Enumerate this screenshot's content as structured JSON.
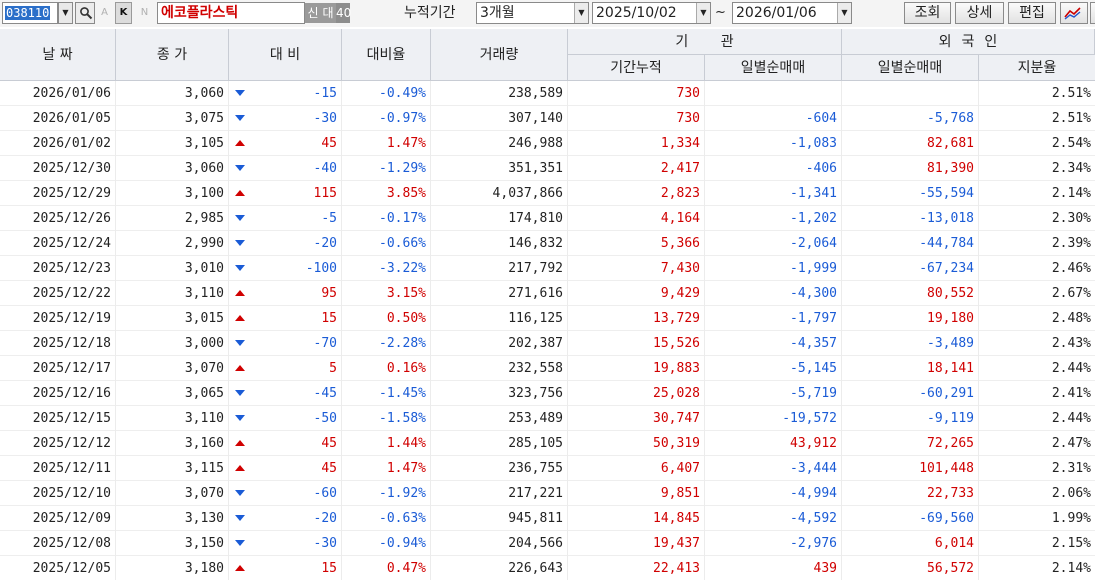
{
  "toolbar": {
    "stock_code": "038110",
    "mini_a": "A",
    "mini_k": "K",
    "mini_n": "N",
    "stock_name": "에코플라스틱",
    "badge_new": "신",
    "badge_credit": "대",
    "badge_margin": "40",
    "period_label": "누적기간",
    "period_value": "3개월",
    "date_from": "2025/10/02",
    "tilde": "~",
    "date_to": "2026/01/06",
    "btn_query": "조회",
    "btn_detail": "상세",
    "btn_edit": "편집"
  },
  "headers": {
    "date": "날 짜",
    "close": "종 가",
    "diff": "대 비",
    "rate": "대비율",
    "volume": "거래량",
    "institution": "기 관",
    "inst_accum": "기간누적",
    "inst_daily": "일별순매매",
    "foreign": "외국인",
    "frn_daily": "일별순매매",
    "frn_share": "지분율"
  },
  "rows": [
    {
      "date": "2026/01/06",
      "close": "3,060",
      "dir": "down",
      "diff": "-15",
      "rate": "-0.49%",
      "volume": "238,589",
      "inst_accum": "730",
      "inst_daily": "",
      "frn_daily": "",
      "frn_share": "2.51%"
    },
    {
      "date": "2026/01/05",
      "close": "3,075",
      "dir": "down",
      "diff": "-30",
      "rate": "-0.97%",
      "volume": "307,140",
      "inst_accum": "730",
      "inst_daily": "-604",
      "frn_daily": "-5,768",
      "frn_share": "2.51%"
    },
    {
      "date": "2026/01/02",
      "close": "3,105",
      "dir": "up",
      "diff": "45",
      "rate": "1.47%",
      "volume": "246,988",
      "inst_accum": "1,334",
      "inst_daily": "-1,083",
      "frn_daily": "82,681",
      "frn_share": "2.54%"
    },
    {
      "date": "2025/12/30",
      "close": "3,060",
      "dir": "down",
      "diff": "-40",
      "rate": "-1.29%",
      "volume": "351,351",
      "inst_accum": "2,417",
      "inst_daily": "-406",
      "frn_daily": "81,390",
      "frn_share": "2.34%"
    },
    {
      "date": "2025/12/29",
      "close": "3,100",
      "dir": "up",
      "diff": "115",
      "rate": "3.85%",
      "volume": "4,037,866",
      "inst_accum": "2,823",
      "inst_daily": "-1,341",
      "frn_daily": "-55,594",
      "frn_share": "2.14%"
    },
    {
      "date": "2025/12/26",
      "close": "2,985",
      "dir": "down",
      "diff": "-5",
      "rate": "-0.17%",
      "volume": "174,810",
      "inst_accum": "4,164",
      "inst_daily": "-1,202",
      "frn_daily": "-13,018",
      "frn_share": "2.30%"
    },
    {
      "date": "2025/12/24",
      "close": "2,990",
      "dir": "down",
      "diff": "-20",
      "rate": "-0.66%",
      "volume": "146,832",
      "inst_accum": "5,366",
      "inst_daily": "-2,064",
      "frn_daily": "-44,784",
      "frn_share": "2.39%"
    },
    {
      "date": "2025/12/23",
      "close": "3,010",
      "dir": "down",
      "diff": "-100",
      "rate": "-3.22%",
      "volume": "217,792",
      "inst_accum": "7,430",
      "inst_daily": "-1,999",
      "frn_daily": "-67,234",
      "frn_share": "2.46%"
    },
    {
      "date": "2025/12/22",
      "close": "3,110",
      "dir": "up",
      "diff": "95",
      "rate": "3.15%",
      "volume": "271,616",
      "inst_accum": "9,429",
      "inst_daily": "-4,300",
      "frn_daily": "80,552",
      "frn_share": "2.67%"
    },
    {
      "date": "2025/12/19",
      "close": "3,015",
      "dir": "up",
      "diff": "15",
      "rate": "0.50%",
      "volume": "116,125",
      "inst_accum": "13,729",
      "inst_daily": "-1,797",
      "frn_daily": "19,180",
      "frn_share": "2.48%"
    },
    {
      "date": "2025/12/18",
      "close": "3,000",
      "dir": "down",
      "diff": "-70",
      "rate": "-2.28%",
      "volume": "202,387",
      "inst_accum": "15,526",
      "inst_daily": "-4,357",
      "frn_daily": "-3,489",
      "frn_share": "2.43%"
    },
    {
      "date": "2025/12/17",
      "close": "3,070",
      "dir": "up",
      "diff": "5",
      "rate": "0.16%",
      "volume": "232,558",
      "inst_accum": "19,883",
      "inst_daily": "-5,145",
      "frn_daily": "18,141",
      "frn_share": "2.44%"
    },
    {
      "date": "2025/12/16",
      "close": "3,065",
      "dir": "down",
      "diff": "-45",
      "rate": "-1.45%",
      "volume": "323,756",
      "inst_accum": "25,028",
      "inst_daily": "-5,719",
      "frn_daily": "-60,291",
      "frn_share": "2.41%"
    },
    {
      "date": "2025/12/15",
      "close": "3,110",
      "dir": "down",
      "diff": "-50",
      "rate": "-1.58%",
      "volume": "253,489",
      "inst_accum": "30,747",
      "inst_daily": "-19,572",
      "frn_daily": "-9,119",
      "frn_share": "2.44%"
    },
    {
      "date": "2025/12/12",
      "close": "3,160",
      "dir": "up",
      "diff": "45",
      "rate": "1.44%",
      "volume": "285,105",
      "inst_accum": "50,319",
      "inst_daily": "43,912",
      "frn_daily": "72,265",
      "frn_share": "2.47%"
    },
    {
      "date": "2025/12/11",
      "close": "3,115",
      "dir": "up",
      "diff": "45",
      "rate": "1.47%",
      "volume": "236,755",
      "inst_accum": "6,407",
      "inst_daily": "-3,444",
      "frn_daily": "101,448",
      "frn_share": "2.31%"
    },
    {
      "date": "2025/12/10",
      "close": "3,070",
      "dir": "down",
      "diff": "-60",
      "rate": "-1.92%",
      "volume": "217,221",
      "inst_accum": "9,851",
      "inst_daily": "-4,994",
      "frn_daily": "22,733",
      "frn_share": "2.06%"
    },
    {
      "date": "2025/12/09",
      "close": "3,130",
      "dir": "down",
      "diff": "-20",
      "rate": "-0.63%",
      "volume": "945,811",
      "inst_accum": "14,845",
      "inst_daily": "-4,592",
      "frn_daily": "-69,560",
      "frn_share": "1.99%"
    },
    {
      "date": "2025/12/08",
      "close": "3,150",
      "dir": "down",
      "diff": "-30",
      "rate": "-0.94%",
      "volume": "204,566",
      "inst_accum": "19,437",
      "inst_daily": "-2,976",
      "frn_daily": "6,014",
      "frn_share": "2.15%"
    },
    {
      "date": "2025/12/05",
      "close": "3,180",
      "dir": "up",
      "diff": "15",
      "rate": "0.47%",
      "volume": "226,643",
      "inst_accum": "22,413",
      "inst_daily": "439",
      "frn_daily": "56,572",
      "frn_share": "2.14%"
    }
  ]
}
